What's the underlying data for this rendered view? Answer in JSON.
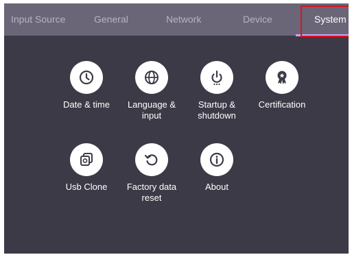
{
  "tabs": [
    {
      "label": "Input Source",
      "active": false
    },
    {
      "label": "General",
      "active": false
    },
    {
      "label": "Network",
      "active": false
    },
    {
      "label": "Device",
      "active": false
    },
    {
      "label": "System",
      "active": true
    }
  ],
  "colors": {
    "background": "#3d3a47",
    "tab_bar": "#6a6678",
    "tab_inactive_text": "#b7b3c3",
    "tab_active_underline": "#c9a8f5",
    "highlight_box": "#e0101e"
  },
  "items": [
    {
      "label": "Date & time",
      "icon": "clock-icon"
    },
    {
      "label": "Language &\ninput",
      "icon": "globe-icon"
    },
    {
      "label": "Startup &\nshutdown",
      "icon": "power-icon"
    },
    {
      "label": "Certification",
      "icon": "award-ribbon-icon"
    },
    {
      "label": "Usb Clone",
      "icon": "copy-icon"
    },
    {
      "label": "Factory data\nreset",
      "icon": "reset-icon"
    },
    {
      "label": "About",
      "icon": "info-icon"
    }
  ]
}
